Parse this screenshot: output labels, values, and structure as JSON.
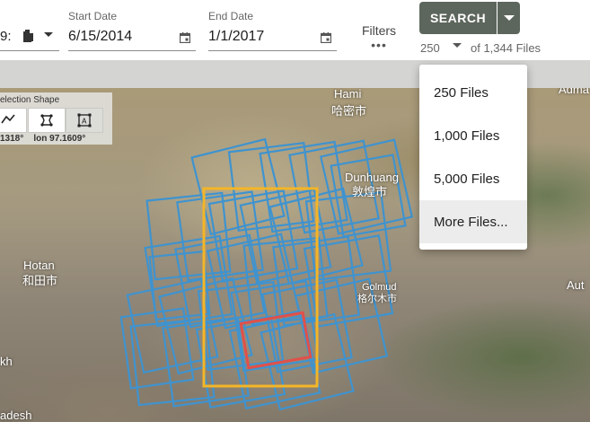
{
  "toolbar": {
    "dataset_value": "9:",
    "start_date": {
      "label": "Start Date",
      "value": "6/15/2014"
    },
    "end_date": {
      "label": "End Date",
      "value": "1/1/2017"
    },
    "filters": {
      "label": "Filters",
      "dots": "•••"
    },
    "search_label": "SEARCH",
    "count": {
      "selected": "250",
      "of_text": "of 1,344 Files"
    }
  },
  "results_menu": {
    "items": [
      {
        "label": "250 Files"
      },
      {
        "label": "1,000 Files"
      },
      {
        "label": "5,000 Files"
      },
      {
        "label": "More Files..."
      }
    ]
  },
  "selection_panel": {
    "title": "election Shape",
    "lat_value": "1318°",
    "lon_label": "lon",
    "lon_value": "97.1609°"
  },
  "map": {
    "places": [
      {
        "text": "Hami"
      },
      {
        "text": "哈密市"
      },
      {
        "text": "Dunhuang"
      },
      {
        "text": "敦煌市"
      },
      {
        "text": "Hotan"
      },
      {
        "text": "和田市"
      },
      {
        "text": "Golmud"
      },
      {
        "text": "格尔木市"
      },
      {
        "text": "Aut"
      },
      {
        "text": "Adma"
      },
      {
        "text": "kh"
      },
      {
        "text": "adesh"
      }
    ],
    "footprint_color": "#3f93cf",
    "aoi_color": "#f4b526",
    "highlight_color": "#e0504a"
  }
}
